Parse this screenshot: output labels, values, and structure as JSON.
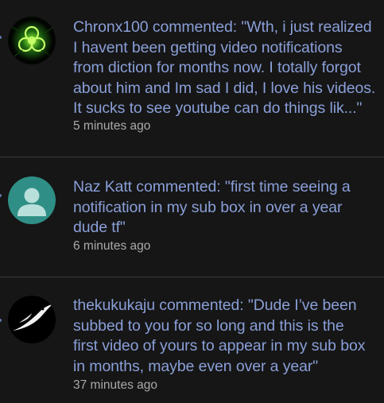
{
  "notifications": [
    {
      "avatar_icon": "green-biohazard-avatar-icon",
      "lines": [
        "Chronx100 commented: \"Wth, i just realized",
        "I havent been getting video notifications",
        "from diction for months now. I totally forgot",
        "about him and Im sad I did, I love his videos.",
        "It sucks to see youtube can do things lik...\""
      ],
      "time": "5 minutes ago"
    },
    {
      "avatar_icon": "default-user-avatar-icon",
      "lines": [
        "Naz Katt commented: \"first time seeing a",
        "notification in my sub box in over a year",
        "dude tf\""
      ],
      "time": "6 minutes ago"
    },
    {
      "avatar_icon": "bird-avatar-icon",
      "lines": [
        "thekukukaju commented: \"Dude I’ve been",
        "subbed to you for so long and this is the",
        "first video of yours to appear in my sub box",
        "in months, maybe even over a year\""
      ],
      "time": "37 minutes ago"
    }
  ],
  "colors": {
    "background": "#161616",
    "comment_text": "#8a9fd8",
    "time_text": "#a9a9a9",
    "divider": "#3c3c3c",
    "teal_avatar": "#2f8f86"
  }
}
